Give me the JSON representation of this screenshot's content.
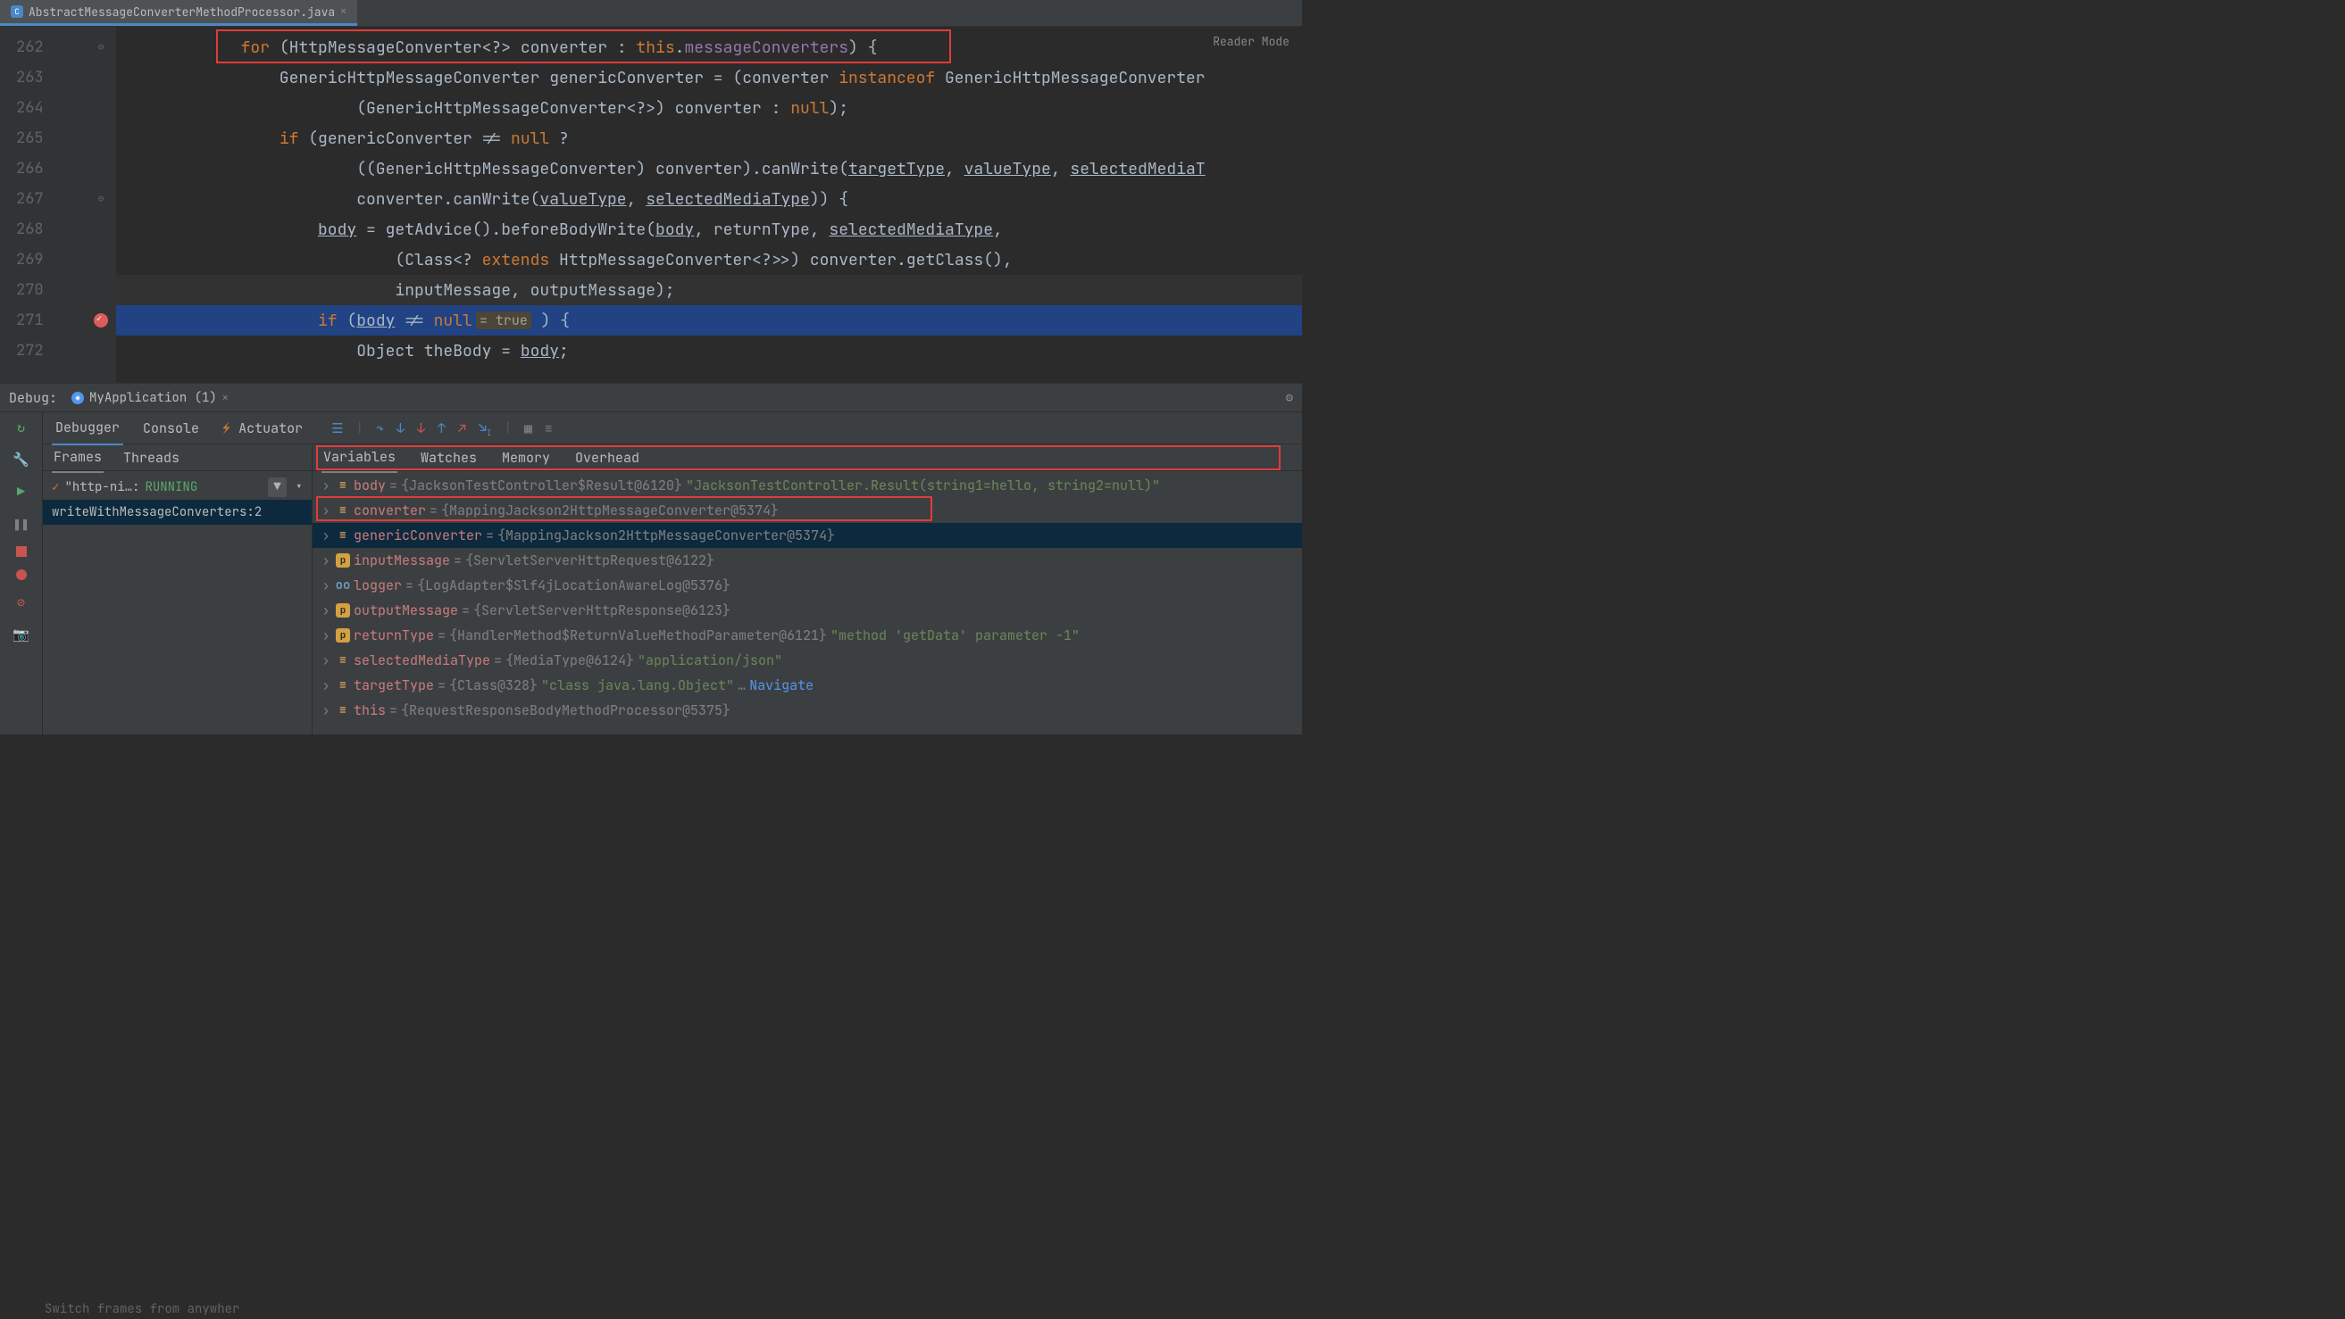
{
  "tab": {
    "filename": "AbstractMessageConverterMethodProcessor.java",
    "readerMode": "Reader Mode"
  },
  "lines": {
    "262": "262",
    "263": "263",
    "264": "264",
    "265": "265",
    "266": "266",
    "267": "267",
    "268": "268",
    "269": "269",
    "270": "270",
    "271": "271",
    "272": "272"
  },
  "code": {
    "l262": {
      "for": "for",
      "open": " (HttpMessageConverter<?> converter : ",
      "this": "this",
      "dot": ".",
      "field": "messageConverters",
      "close": ") {"
    },
    "l263": {
      "pre": "                GenericHttpMessageConverter genericConverter = (converter ",
      "kw": "instanceof",
      "rest": " GenericHttpMessageConverter"
    },
    "l264": {
      "pre": "                        (GenericHttpMessageConverter<?>) converter : ",
      "nul": "null",
      "end": ");"
    },
    "l265": {
      "pre": "                ",
      "if": "if",
      "mid": " (genericConverter != ",
      "nul": "null",
      "end": " ?"
    },
    "l266": {
      "pre": "                        ((GenericHttpMessageConverter) converter).canWrite(",
      "t1": "targetType",
      "c1": ", ",
      "t2": "valueType",
      "c2": ", ",
      "t3": "selectedMediaT"
    },
    "l267": {
      "pre": "                        converter.canWrite(",
      "t1": "valueType",
      "c1": ", ",
      "t2": "selectedMediaType",
      "end": ")) {"
    },
    "l268": {
      "pre": "                    ",
      "body": "body",
      "mid": " = getAdvice().beforeBodyWrite(",
      "b2": "body",
      "c1": ", returnType, ",
      "smt": "selectedMediaType",
      "end": ","
    },
    "l269": {
      "pre": "                            (Class<? ",
      "ext": "extends",
      "rest": " HttpMessageConverter<?>>) converter.getClass(),"
    },
    "l270": {
      "txt": "                            inputMessage, outputMessage);"
    },
    "l271": {
      "pre": "                    ",
      "if": "if",
      "open": " (",
      "body": "body",
      "neq": " != ",
      "nul": "null",
      "hint": "= true",
      "end": " ) {"
    },
    "l272": {
      "pre": "                        Object theBody = ",
      "body": "body",
      "end": ";"
    }
  },
  "debug": {
    "label": "Debug:",
    "configName": "MyApplication (1)",
    "tabs": {
      "debugger": "Debugger",
      "console": "Console",
      "actuator": "Actuator"
    },
    "frames": {
      "tabs": {
        "frames": "Frames",
        "threads": "Threads"
      },
      "thread": {
        "name": "\"http-ni…: ",
        "status": "RUNNING"
      },
      "stackItem": "writeWithMessageConverters:2",
      "switchHint": "Switch frames from anywher"
    },
    "vars": {
      "tabs": {
        "variables": "Variables",
        "watches": "Watches",
        "memory": "Memory",
        "overhead": "Overhead"
      },
      "items": [
        {
          "icon": "obj-lines",
          "name": "body",
          "val": "{JacksonTestController$Result@6120}",
          "str": "\"JacksonTestController.Result(string1=hello, string2=null)\""
        },
        {
          "icon": "obj-lines",
          "name": "converter",
          "val": "{MappingJackson2HttpMessageConverter@5374}"
        },
        {
          "icon": "obj-lines",
          "name": "genericConverter",
          "val": "{MappingJackson2HttpMessageConverter@5374}",
          "selected": true
        },
        {
          "icon": "param",
          "iconText": "p",
          "name": "inputMessage",
          "val": "{ServletServerHttpRequest@6122}"
        },
        {
          "icon": "glasses",
          "iconText": "oo",
          "name": "logger",
          "val": "{LogAdapter$Slf4jLocationAwareLog@5376}"
        },
        {
          "icon": "param",
          "iconText": "p",
          "name": "outputMessage",
          "val": "{ServletServerHttpResponse@6123}"
        },
        {
          "icon": "param",
          "iconText": "p",
          "name": "returnType",
          "val": "{HandlerMethod$ReturnValueMethodParameter@6121}",
          "str": "\"method 'getData' parameter -1\""
        },
        {
          "icon": "obj-lines",
          "name": "selectedMediaType",
          "val": "{MediaType@6124}",
          "str": "\"application/json\""
        },
        {
          "icon": "obj-lines",
          "name": "targetType",
          "val": "{Class@328}",
          "str": "\"class java.lang.Object\"",
          "ellipsis": "…",
          "link": "Navigate"
        },
        {
          "icon": "obj-lines",
          "name": "this",
          "val": "{RequestResponseBodyMethodProcessor@5375}"
        }
      ]
    }
  }
}
